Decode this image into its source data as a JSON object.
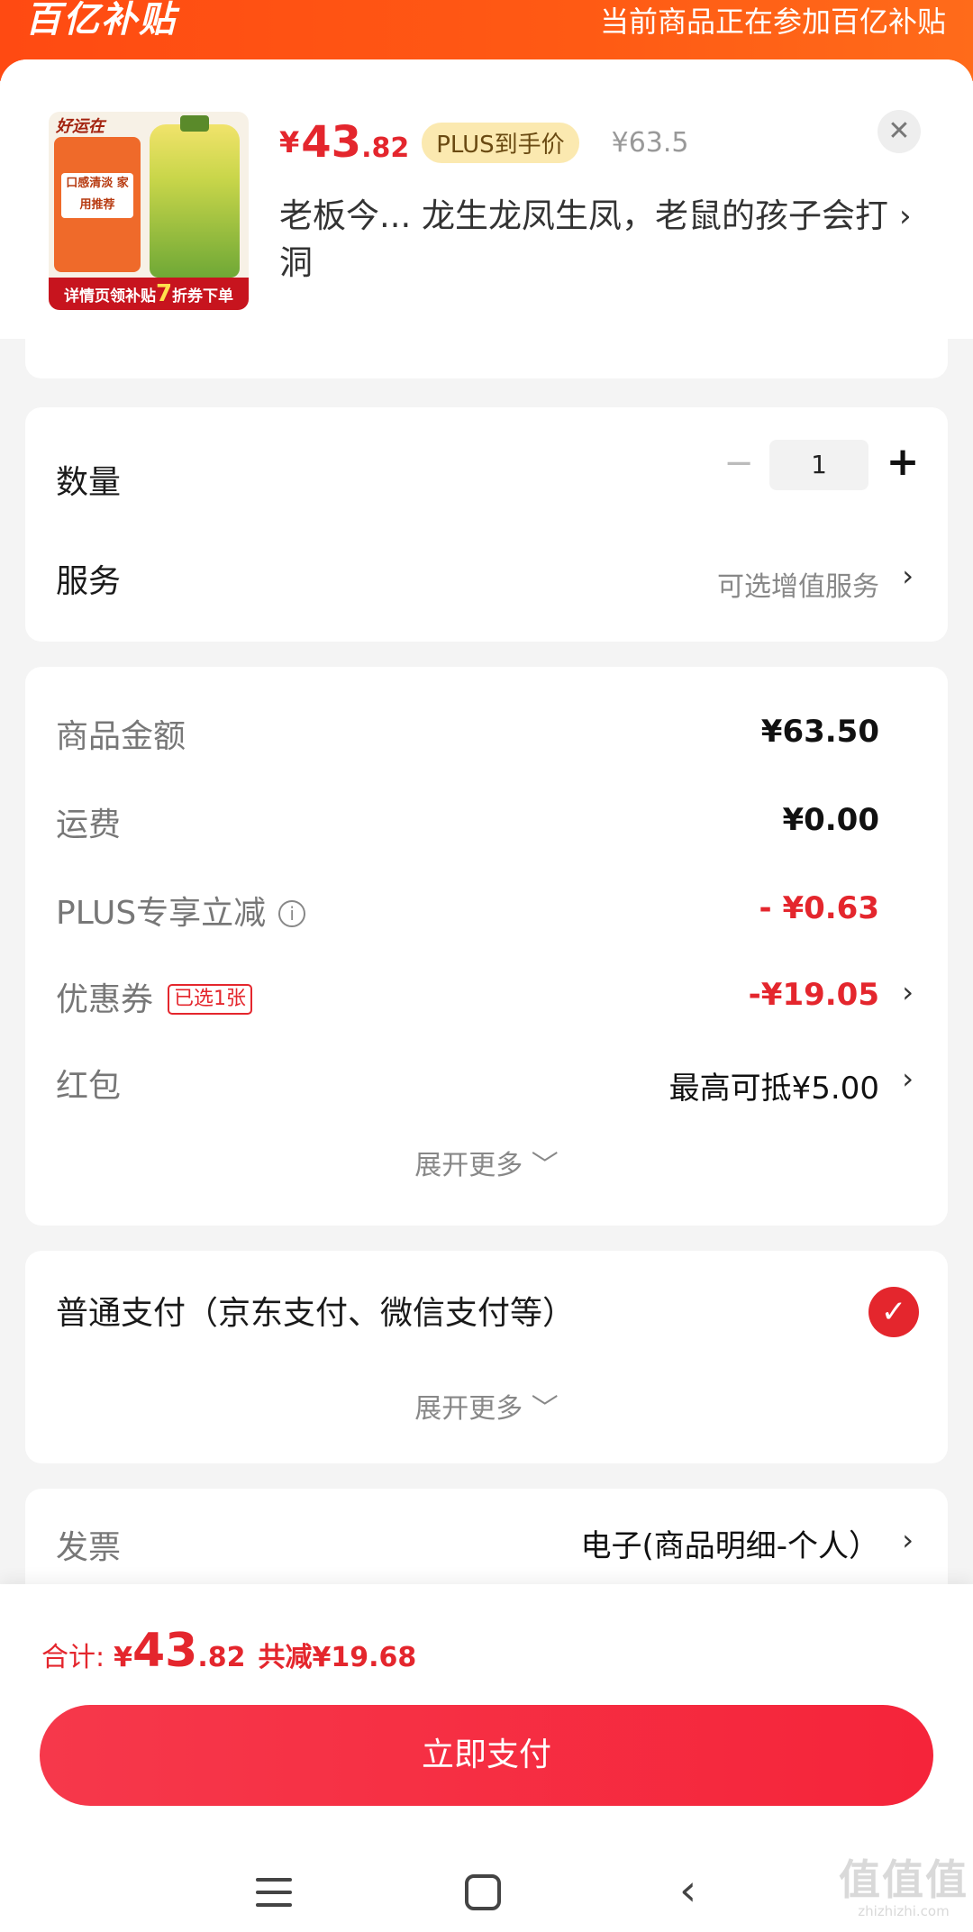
{
  "banner": {
    "logo_text": "百亿补贴",
    "notice": "当前商品正在参加百亿补贴"
  },
  "product": {
    "image_brand": "好运在",
    "image_tag": "口感清淡 家用推荐",
    "image_strip": {
      "prefix": "详情页领补贴",
      "big": "7",
      "suffix": "折券下单"
    },
    "price_symbol": "¥",
    "price_int": "43",
    "price_dec": ".82",
    "plus_badge": "PLUS到手价",
    "original_price": "¥63.5",
    "title": "老板今... 龙生龙凤生凤，老鼠的孩子会打洞",
    "close_icon": "✕",
    "arrow": "›"
  },
  "quantity": {
    "label": "数量",
    "minus": "−",
    "value": "1",
    "plus": "+"
  },
  "service": {
    "label": "服务",
    "value": "可选增值服务",
    "arrow": "›"
  },
  "pricing": {
    "rows": [
      {
        "label": "商品金额",
        "value": "¥63.50"
      },
      {
        "label": "运费",
        "value": "¥0.00"
      },
      {
        "label": "PLUS专享立减",
        "value": "- ¥0.63"
      },
      {
        "label": "优惠券",
        "tag": "已选1张",
        "value": "-¥19.05"
      },
      {
        "label": "红包",
        "value": "最高可抵¥5.00"
      }
    ],
    "expand": "展开更多 ﹀"
  },
  "payment": {
    "label": "普通支付（京东支付、微信支付等）",
    "expand": "展开更多 ﹀"
  },
  "invoice": {
    "label": "发票",
    "value": "电子(商品明细-个人）"
  },
  "footer": {
    "total_label": "合计:",
    "total_symbol": "¥",
    "total_int": "43",
    "total_dec": ".82",
    "saved": "共减¥19.68",
    "pay_button": "立即支付"
  },
  "watermark": {
    "line1": "值值值",
    "line2": "zhizhizhi.com"
  },
  "colors": {
    "accent": "#e4262d",
    "banner": "#ff4a12"
  }
}
